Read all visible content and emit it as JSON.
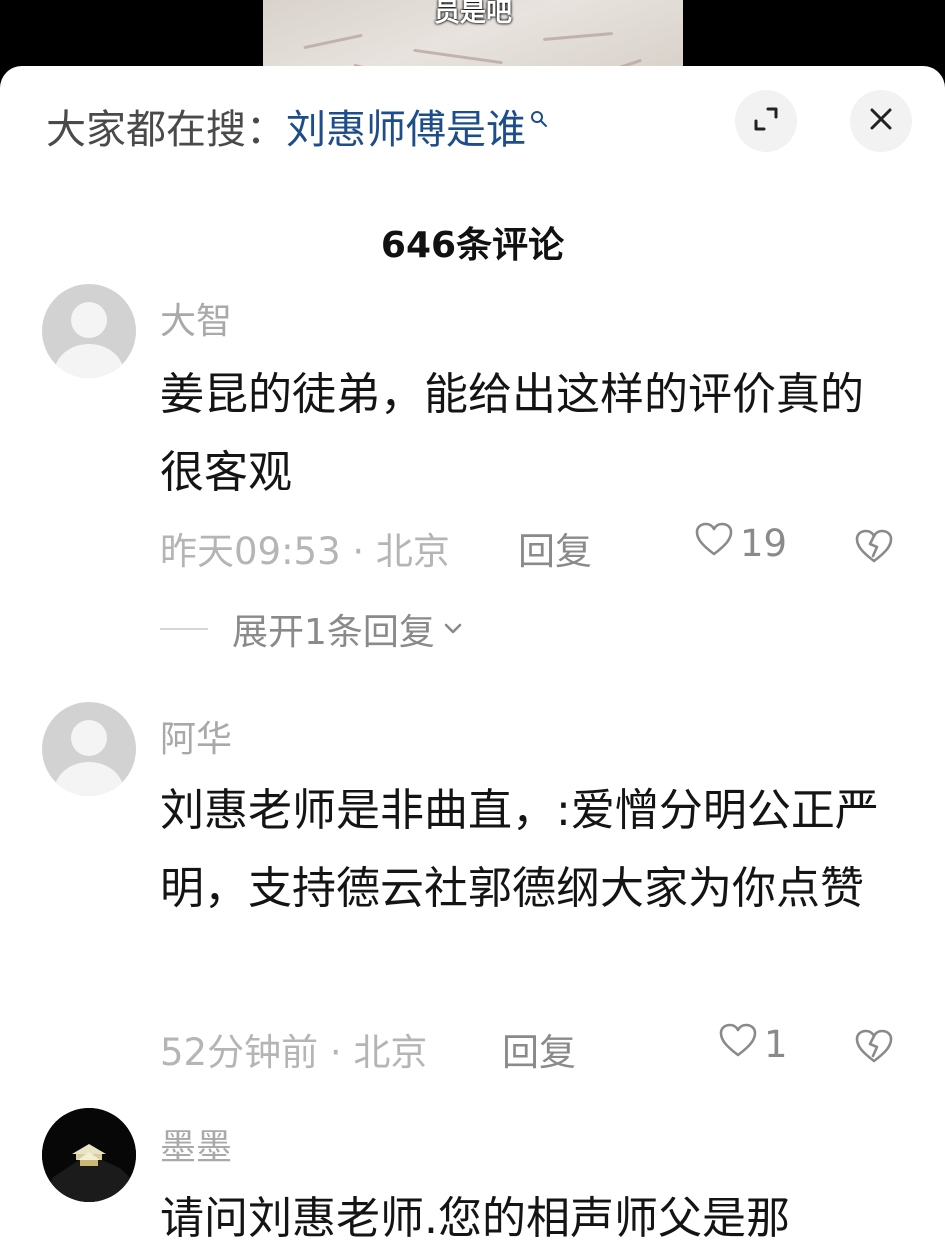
{
  "video": {
    "caption": "员是吧"
  },
  "search": {
    "prefix": "大家都在搜：",
    "term": "刘惠师傅是谁"
  },
  "header": {
    "comment_count": "646条评论"
  },
  "comments": [
    {
      "username": "大智",
      "text": "姜昆的徒弟，能给出这样的评价真的很客观",
      "meta": "昨天09:53 · 北京",
      "reply_label": "回复",
      "likes": "19",
      "expand_replies": "展开1条回复"
    },
    {
      "username": "阿华",
      "text": "刘惠老师是非曲直，:爱憎分明公正严明，支持德云社郭德纲大家为你点赞",
      "meta": "52分钟前 · 北京",
      "reply_label": "回复",
      "likes": "1"
    },
    {
      "username": "墨墨",
      "text": "请问刘惠老师.您的相声师父是那"
    }
  ]
}
